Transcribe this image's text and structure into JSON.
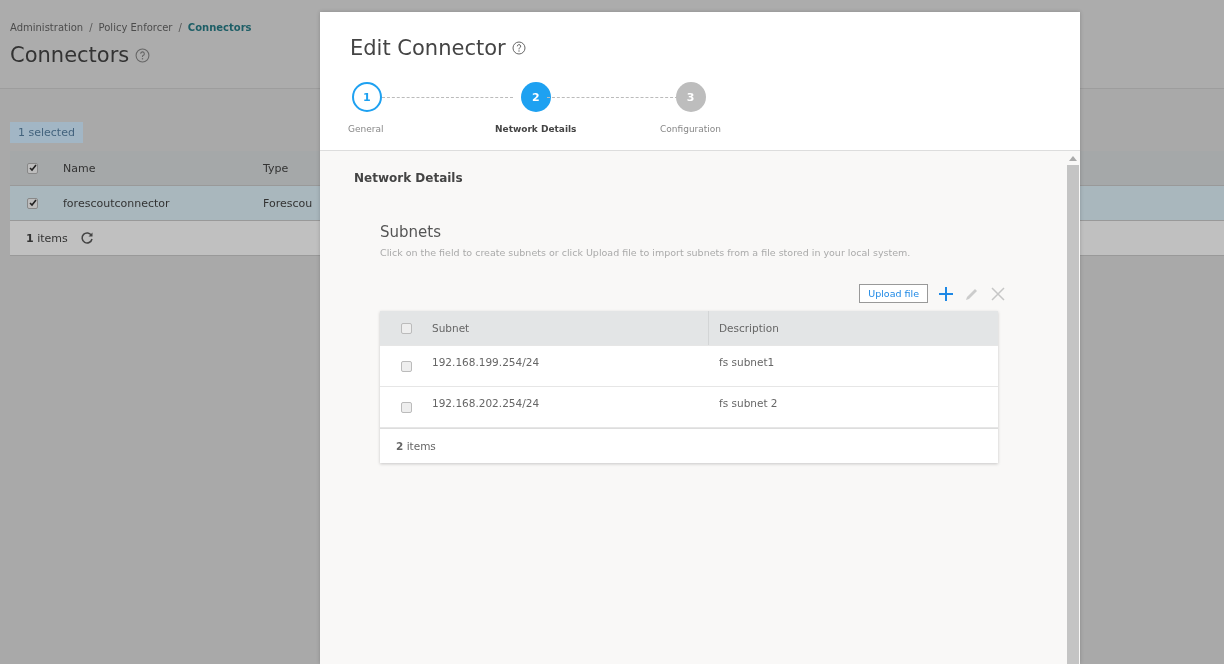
{
  "background_page": {
    "breadcrumb": [
      {
        "kind": "link",
        "label": "Administration",
        "current": false
      },
      {
        "kind": "separator",
        "label": "/"
      },
      {
        "kind": "link",
        "label": "Policy Enforcer",
        "current": false
      },
      {
        "kind": "separator",
        "label": "/"
      },
      {
        "kind": "link",
        "label": "Connectors",
        "current": true
      }
    ],
    "title": "Connectors",
    "selection_badge": "1 selected",
    "table": {
      "header_checked": true,
      "columns": [
        "Name",
        "Type"
      ],
      "rows": [
        {
          "selected": true,
          "cells": [
            "forescoutconnector",
            "Forescou"
          ]
        }
      ],
      "footer": "**1** items"
    }
  },
  "dialog": {
    "title": "Edit Connector",
    "steps": [
      {
        "number": "1",
        "label": "General",
        "completed": true,
        "selected": false
      },
      {
        "number": "2",
        "label": "Network Details",
        "completed": false,
        "selected": true
      },
      {
        "number": "3",
        "label": "Configuration",
        "completed": false,
        "selected": false
      }
    ],
    "section_title": "Network Details",
    "subnets": {
      "title": "Subnets",
      "description": "Click on the field to create subnets or click Upload file to import subnets from a file stored in your local system.",
      "upload_button": "Upload file",
      "table": {
        "header_checked": false,
        "columns": [
          "Subnet",
          "Description"
        ],
        "rows": [
          {
            "checked": false,
            "cells": [
              "192.168.199.254/24",
              "fs subnet1"
            ]
          },
          {
            "checked": false,
            "cells": [
              "192.168.202.254/24",
              "fs subnet 2"
            ]
          }
        ],
        "footer": "**2** items"
      }
    }
  }
}
